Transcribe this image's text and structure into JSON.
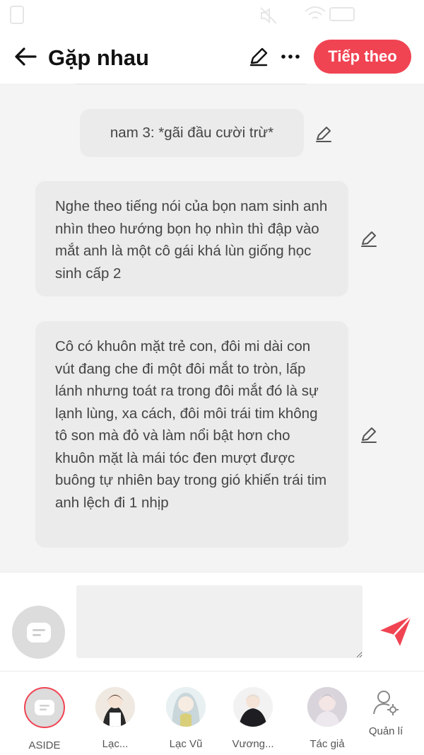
{
  "header": {
    "title": "Gặp nhau",
    "next_label": "Tiếp theo"
  },
  "messages": [
    {
      "text": "nam 3: *gãi đầu cười trừ*",
      "type": "narration"
    },
    {
      "text": "Nghe theo tiếng nói của bọn nam sinh anh nhìn theo hướng bọn họ nhìn thì đập vào mắt anh là một cô gái khá lùn giống học sinh cấp 2",
      "type": "aside"
    },
    {
      "text": "Cô có khuôn mặt trẻ con, đôi mi dài con vút đang che đi một đôi mắt to tròn, lấp lánh nhưng toát ra trong đôi mắt đó là sự lạnh lùng, xa cách, đôi môi trái tim không tô son mà đỏ và làm nổi bật hơn cho khuôn mặt là mái tóc đen mượt được buông tự nhiên bay trong gió khiến trái tim anh lệch đi 1 nhịp",
      "type": "aside"
    }
  ],
  "composer": {
    "input_value": "",
    "input_placeholder": ""
  },
  "characters": [
    {
      "label": "ASIDE",
      "selected": true
    },
    {
      "label": "Lạc..."
    },
    {
      "label": "Lạc Vũ"
    },
    {
      "label": "Vương..."
    },
    {
      "label": "Tác giả"
    },
    {
      "label": "Quản lí"
    }
  ],
  "colors": {
    "accent": "#f04453",
    "bubble": "#ebebeb",
    "background": "#f4f4f4"
  },
  "icons": [
    "back-arrow-icon",
    "pencil-icon",
    "more-icon",
    "aside-icon",
    "send-icon",
    "user-settings-icon"
  ]
}
